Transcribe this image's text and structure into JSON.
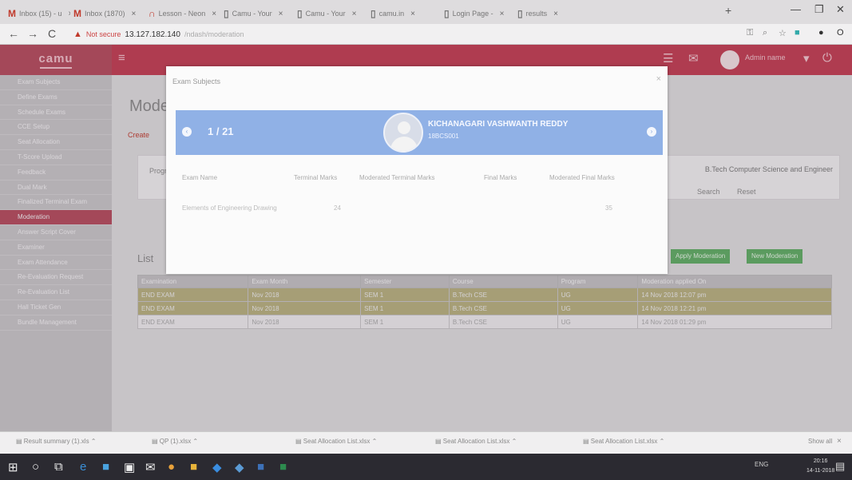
{
  "browser": {
    "tabs": [
      "Inbox (15) - u",
      "Inbox (1870)",
      "Lesson - Neon",
      "Camu - Your",
      "Camu - Your",
      "camu.in",
      "Login Page -",
      "results"
    ],
    "new_tab": "+",
    "not_secure": "Not secure",
    "host": "13.127.182.140",
    "path": "/ndash/moderation"
  },
  "app": {
    "logo": "camu",
    "sidebar": [
      "Exam Subjects",
      "Define Exams",
      "Schedule Exams",
      "CCE Setup",
      "Seat Allocation",
      "T-Score Upload",
      "Feedback",
      "Dual Mark",
      "Finalized Terminal Exam",
      "Moderation",
      "Answer Script Cover",
      "Examiner",
      "Exam Attendance",
      "Re-Evaluation Request",
      "Re-Evaluation List",
      "Hall Ticket Gen",
      "Bundle Management"
    ],
    "active_index": 9,
    "topbar_user": "Admin name",
    "page_title": "Mode",
    "tab_label": "Create",
    "filter_program": "Program",
    "filter_select": "B.Tech Computer Science and Engineer",
    "search_btn": "Search",
    "reset_btn": "Reset",
    "list_title": "List",
    "btn_apply": "Apply Moderation",
    "btn_new": "New Moderation",
    "table": {
      "headers": [
        "Examination",
        "Exam Month",
        "Semester",
        "Course",
        "Program",
        "Moderation applied On"
      ],
      "rows": [
        [
          "END EXAM",
          "Nov 2018",
          "SEM 1",
          "B.Tech CSE",
          "UG",
          "14 Nov 2018 12:07 pm"
        ],
        [
          "END EXAM",
          "Nov 2018",
          "SEM 1",
          "B.Tech CSE",
          "UG",
          "14 Nov 2018 12:21 pm"
        ],
        [
          "END EXAM",
          "Nov 2018",
          "SEM 1",
          "B.Tech CSE",
          "UG",
          "14 Nov 2018 01:29 pm"
        ]
      ]
    }
  },
  "modal": {
    "title": "Exam Subjects",
    "counter": "1 / 21",
    "student_name": "KICHANAGARI VASHWANTH REDDY",
    "roll_no": "18BCS001",
    "headers": [
      "Exam Name",
      "Terminal Marks",
      "Moderated Terminal Marks",
      "Final Marks",
      "Moderated Final Marks"
    ],
    "row": [
      "Elements of Engineering Drawing",
      "24",
      "",
      "",
      "35"
    ]
  },
  "downloads": {
    "items": [
      "Result summary (1).xls",
      "QP (1).xlsx",
      "Seat Allocation List.xlsx",
      "Seat Allocation List.xlsx",
      "Seat Allocation List.xlsx"
    ],
    "show_all": "Show all"
  },
  "taskbar": {
    "tray": "ENG",
    "time": "20:16",
    "date": "14-11-2018"
  }
}
